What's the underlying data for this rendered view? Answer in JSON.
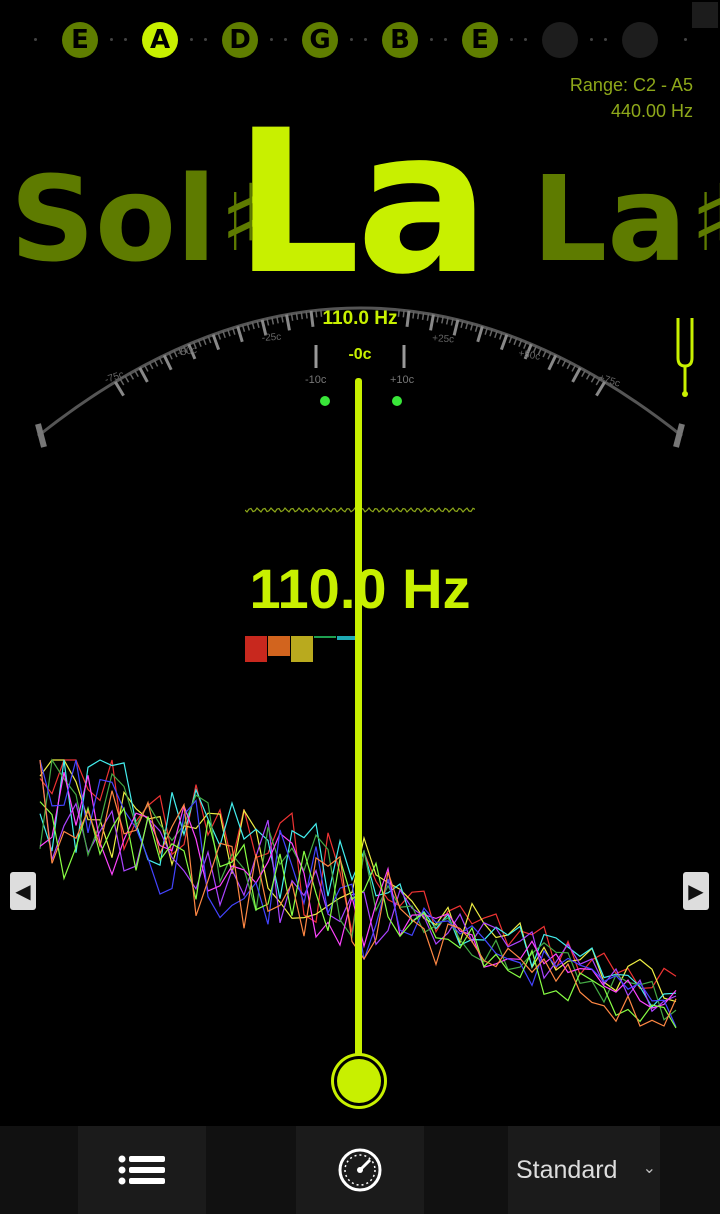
{
  "strings": {
    "notes": [
      "E",
      "A",
      "D",
      "G",
      "B",
      "E",
      "",
      ""
    ],
    "active_index": 1
  },
  "range": {
    "label": "Range: C2 - A5",
    "reference": "440.00 Hz"
  },
  "note": {
    "left": "Sol",
    "left_sharp": "♯",
    "center": "La",
    "right": "La",
    "right_sharp": "♯"
  },
  "meter": {
    "freq": "110.0 Hz",
    "cents": "-0c",
    "ticks": [
      "-75c",
      "-50c",
      "-25c",
      "-10c",
      "+10c",
      "+25c",
      "+50c",
      "+75c"
    ]
  },
  "main": {
    "frequency": "110.0 Hz"
  },
  "harmonic_bars": {
    "colors": [
      "#c8281e",
      "#d2641e",
      "#b9aa1e",
      "#1ea050",
      "#1eaab4"
    ]
  },
  "nav": {
    "prev_icon": "◀",
    "next_icon": "▶"
  },
  "toolbar": {
    "tuning": "Standard",
    "chevron": "⌄"
  },
  "colors": {
    "accent": "#c8f000",
    "dim_accent": "#5e7b00",
    "background": "#000000"
  }
}
